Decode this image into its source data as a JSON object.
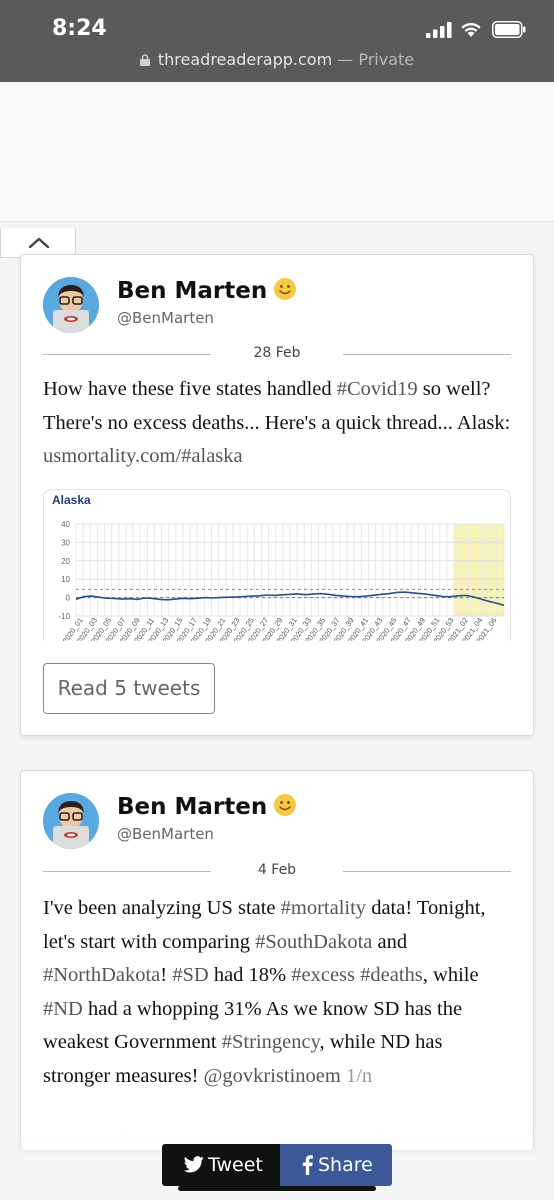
{
  "status": {
    "time": "8:24"
  },
  "browser": {
    "url": "threadreaderapp.com",
    "privacy": "— Private"
  },
  "threads": [
    {
      "author": "Ben Marten",
      "handle": "@BenMarten",
      "date": "28 Feb",
      "text_parts": [
        "How have these five states handled ",
        "#Covid19",
        " so well? There's no excess deaths... Here's a quick thread... Alask: ",
        "usmortality.com/#alaska"
      ],
      "read_button": "Read 5 tweets"
    },
    {
      "author": "Ben Marten",
      "handle": "@BenMarten",
      "date": "4 Feb",
      "text_parts": [
        "I've been analyzing US state ",
        "#mortality",
        " data! Tonight, let's start with comparing ",
        "#SouthDakota",
        " and ",
        "#NorthDakota",
        "! ",
        "#SD",
        " had 18% ",
        "#excess",
        " ",
        "#deaths",
        ", while ",
        "#ND",
        " had a whopping 31% As we know SD has the weakest Government ",
        "#Stringency",
        ", while ND has stronger measures! ",
        "@govkristinoem",
        " ",
        "1/n"
      ]
    }
  ],
  "chart_data": {
    "type": "line",
    "title": "Alaska",
    "ylim": [
      -10,
      40
    ],
    "yticks": [
      "40",
      "30",
      "20",
      "10",
      "0",
      "-10"
    ],
    "x_tick_labels": [
      "2020_01",
      "2020_03",
      "2020_05",
      "2020_07",
      "2020_09",
      "2020_11",
      "2020_13",
      "2020_15",
      "2020_17",
      "2020_19",
      "2020_21",
      "2020_23",
      "2020_25",
      "2020_27",
      "2020_29",
      "2020_31",
      "2020_33",
      "2020_35",
      "2020_37",
      "2020_39",
      "2020_41",
      "2020_43",
      "2020_45",
      "2020_47",
      "2020_49",
      "2020_51",
      "2020_53",
      "2021_02",
      "2021_04",
      "2021_06"
    ],
    "series": [
      {
        "values": [
          -1,
          0.5,
          0.8,
          0.2,
          -0.3,
          -0.5,
          -0.8,
          -0.6,
          -1,
          -0.2,
          -0.5,
          -1,
          -1.2,
          -0.8,
          -0.4,
          -0.6,
          -0.3,
          0,
          -0.2,
          0.1,
          0.2,
          0.4,
          0.6,
          0.8,
          1,
          1.4,
          1.2,
          1.5,
          1.8,
          2,
          1.6,
          1.9,
          2.2,
          1.8,
          1.2,
          0.8,
          0.6,
          0.5,
          0.8,
          1.3,
          1.8,
          2.2,
          2.8,
          3,
          2.6,
          2.2,
          1.8,
          1.2,
          0.6,
          0.5,
          1.0,
          1.2,
          0.4,
          -0.8,
          -2,
          -3,
          -4.2
        ],
        "color": "#2b4f85"
      }
    ],
    "reference_lines": [
      {
        "value": 4.5,
        "color": "#d86a6a",
        "style": "dashed"
      },
      {
        "value": 0,
        "color": "#5a7fb8",
        "style": "dashed"
      }
    ],
    "highlight_region": {
      "from": "2020_53",
      "to": "2021_06",
      "color": "#f7f3b8"
    },
    "grid": true
  },
  "share": {
    "tweet": "Tweet",
    "share": "Share"
  }
}
